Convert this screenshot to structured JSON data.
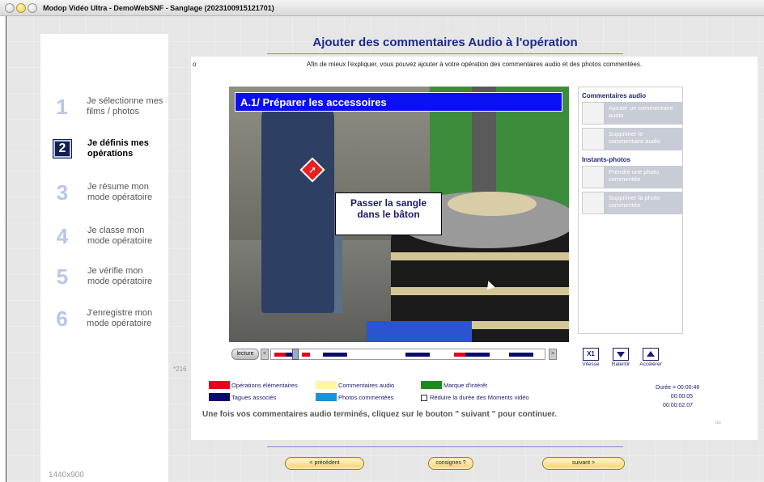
{
  "window": {
    "title": "Modop Vidéo Ultra - DemoWebSNF - Sanglage (2023100915121701)"
  },
  "steps": [
    {
      "num": "1",
      "label": "Je sélectionne mes films / photos",
      "active": false
    },
    {
      "num": "2",
      "label": "Je définis mes opérations",
      "active": true
    },
    {
      "num": "3",
      "label": "Je résume mon mode opératoire",
      "active": false
    },
    {
      "num": "4",
      "label": "Je classe mon mode opératoire",
      "active": false
    },
    {
      "num": "5",
      "label": "Je vérifie mon mode opératoire",
      "active": false
    },
    {
      "num": "6",
      "label": "J'enregistre mon mode opératoire",
      "active": false
    }
  ],
  "resolution": "1440x900",
  "page_title": "Ajouter des commentaires Audio à l'opération",
  "small_marker": "o",
  "intro": "Afin de mieux l'expliquer, vous pouvez ajouter à votre opération des commentaires audio et des photos commentées.",
  "video": {
    "headline": "A.1/ Préparer les accessoires",
    "caption_line1": "Passer la sangle",
    "caption_line2": "dans le bâton"
  },
  "side_panel": {
    "audio_heading": "Commentaires audio",
    "add_audio": "Ajouter un commentaire audio",
    "delete_audio": "Supprimer le commentaire audio",
    "photos_heading": "Instants-photos",
    "take_photo": "Prendre une photo commentée",
    "delete_photo": "Supprimer la photo commentée"
  },
  "timeline": {
    "play_label": "lecture",
    "left_arrow": "<",
    "right_arrow": ">"
  },
  "controls": {
    "speed_value": "X1",
    "speed_label": "Vitesse",
    "slow_label": "Ralentir",
    "fast_label": "Accélérer"
  },
  "side_number": "*216",
  "legend": {
    "elementary_ops": "Opérations élémentaires",
    "associated_tags": "Tagues associés",
    "audio_comments": "Commentaires audio",
    "photo_comments": "Photos commentées",
    "interest_mark": "Marque d'intérêt",
    "reduce_moments": "Réduire la durée des Moments vidéo"
  },
  "colors": {
    "red": "#e8001a",
    "navy": "#0a0a6e",
    "yellow": "#fff7a3",
    "blue": "#1a93d6",
    "green": "#1e8a1e"
  },
  "durations": {
    "total": "Durée = 00:00:46",
    "current": "00:00:05",
    "precise": "00:00:02.07"
  },
  "bottom_message": "Une fois vos commentaires audio terminés, cliquez sur le bouton \" suivant \" pour continuer.",
  "tiny_marker": "oo",
  "nav": {
    "prev": "< précédent",
    "instructions": "consignes ?",
    "next": "suivant >"
  }
}
